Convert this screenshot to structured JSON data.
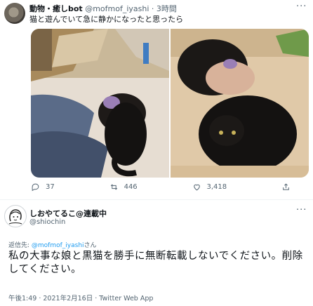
{
  "tweet1": {
    "display_name": "動物・癒しbot",
    "handle": "@mofmof_iyashi",
    "separator": "·",
    "time": "3時間",
    "text": "猫と遊んでいて急に静かになったと思ったら",
    "avatar": "cat-avatar",
    "images": [
      "child-with-black-cat-photo-1",
      "child-with-black-cat-photo-2"
    ],
    "actions": {
      "reply_count": "37",
      "retweet_count": "446",
      "like_count": "3,418",
      "share_icon": "share-icon"
    }
  },
  "tweet2": {
    "display_name": "しおやてるこ@連載中",
    "handle": "@shiochin",
    "reply_prefix": "返信先: ",
    "reply_to": "@mofmof_iyashi",
    "reply_suffix": "さん",
    "text": "私の大事な娘と黒猫を勝手に無断転載しないでください。削除してください。",
    "timestamp": "午後1:49 · 2021年2月16日 · Twitter Web App",
    "avatar": "illustrated-face-avatar"
  },
  "menu_glyph": "···",
  "colors": {
    "text": "#0f1419",
    "secondary": "#536471",
    "link": "#1d9bf0",
    "divider": "#eff3f4"
  }
}
